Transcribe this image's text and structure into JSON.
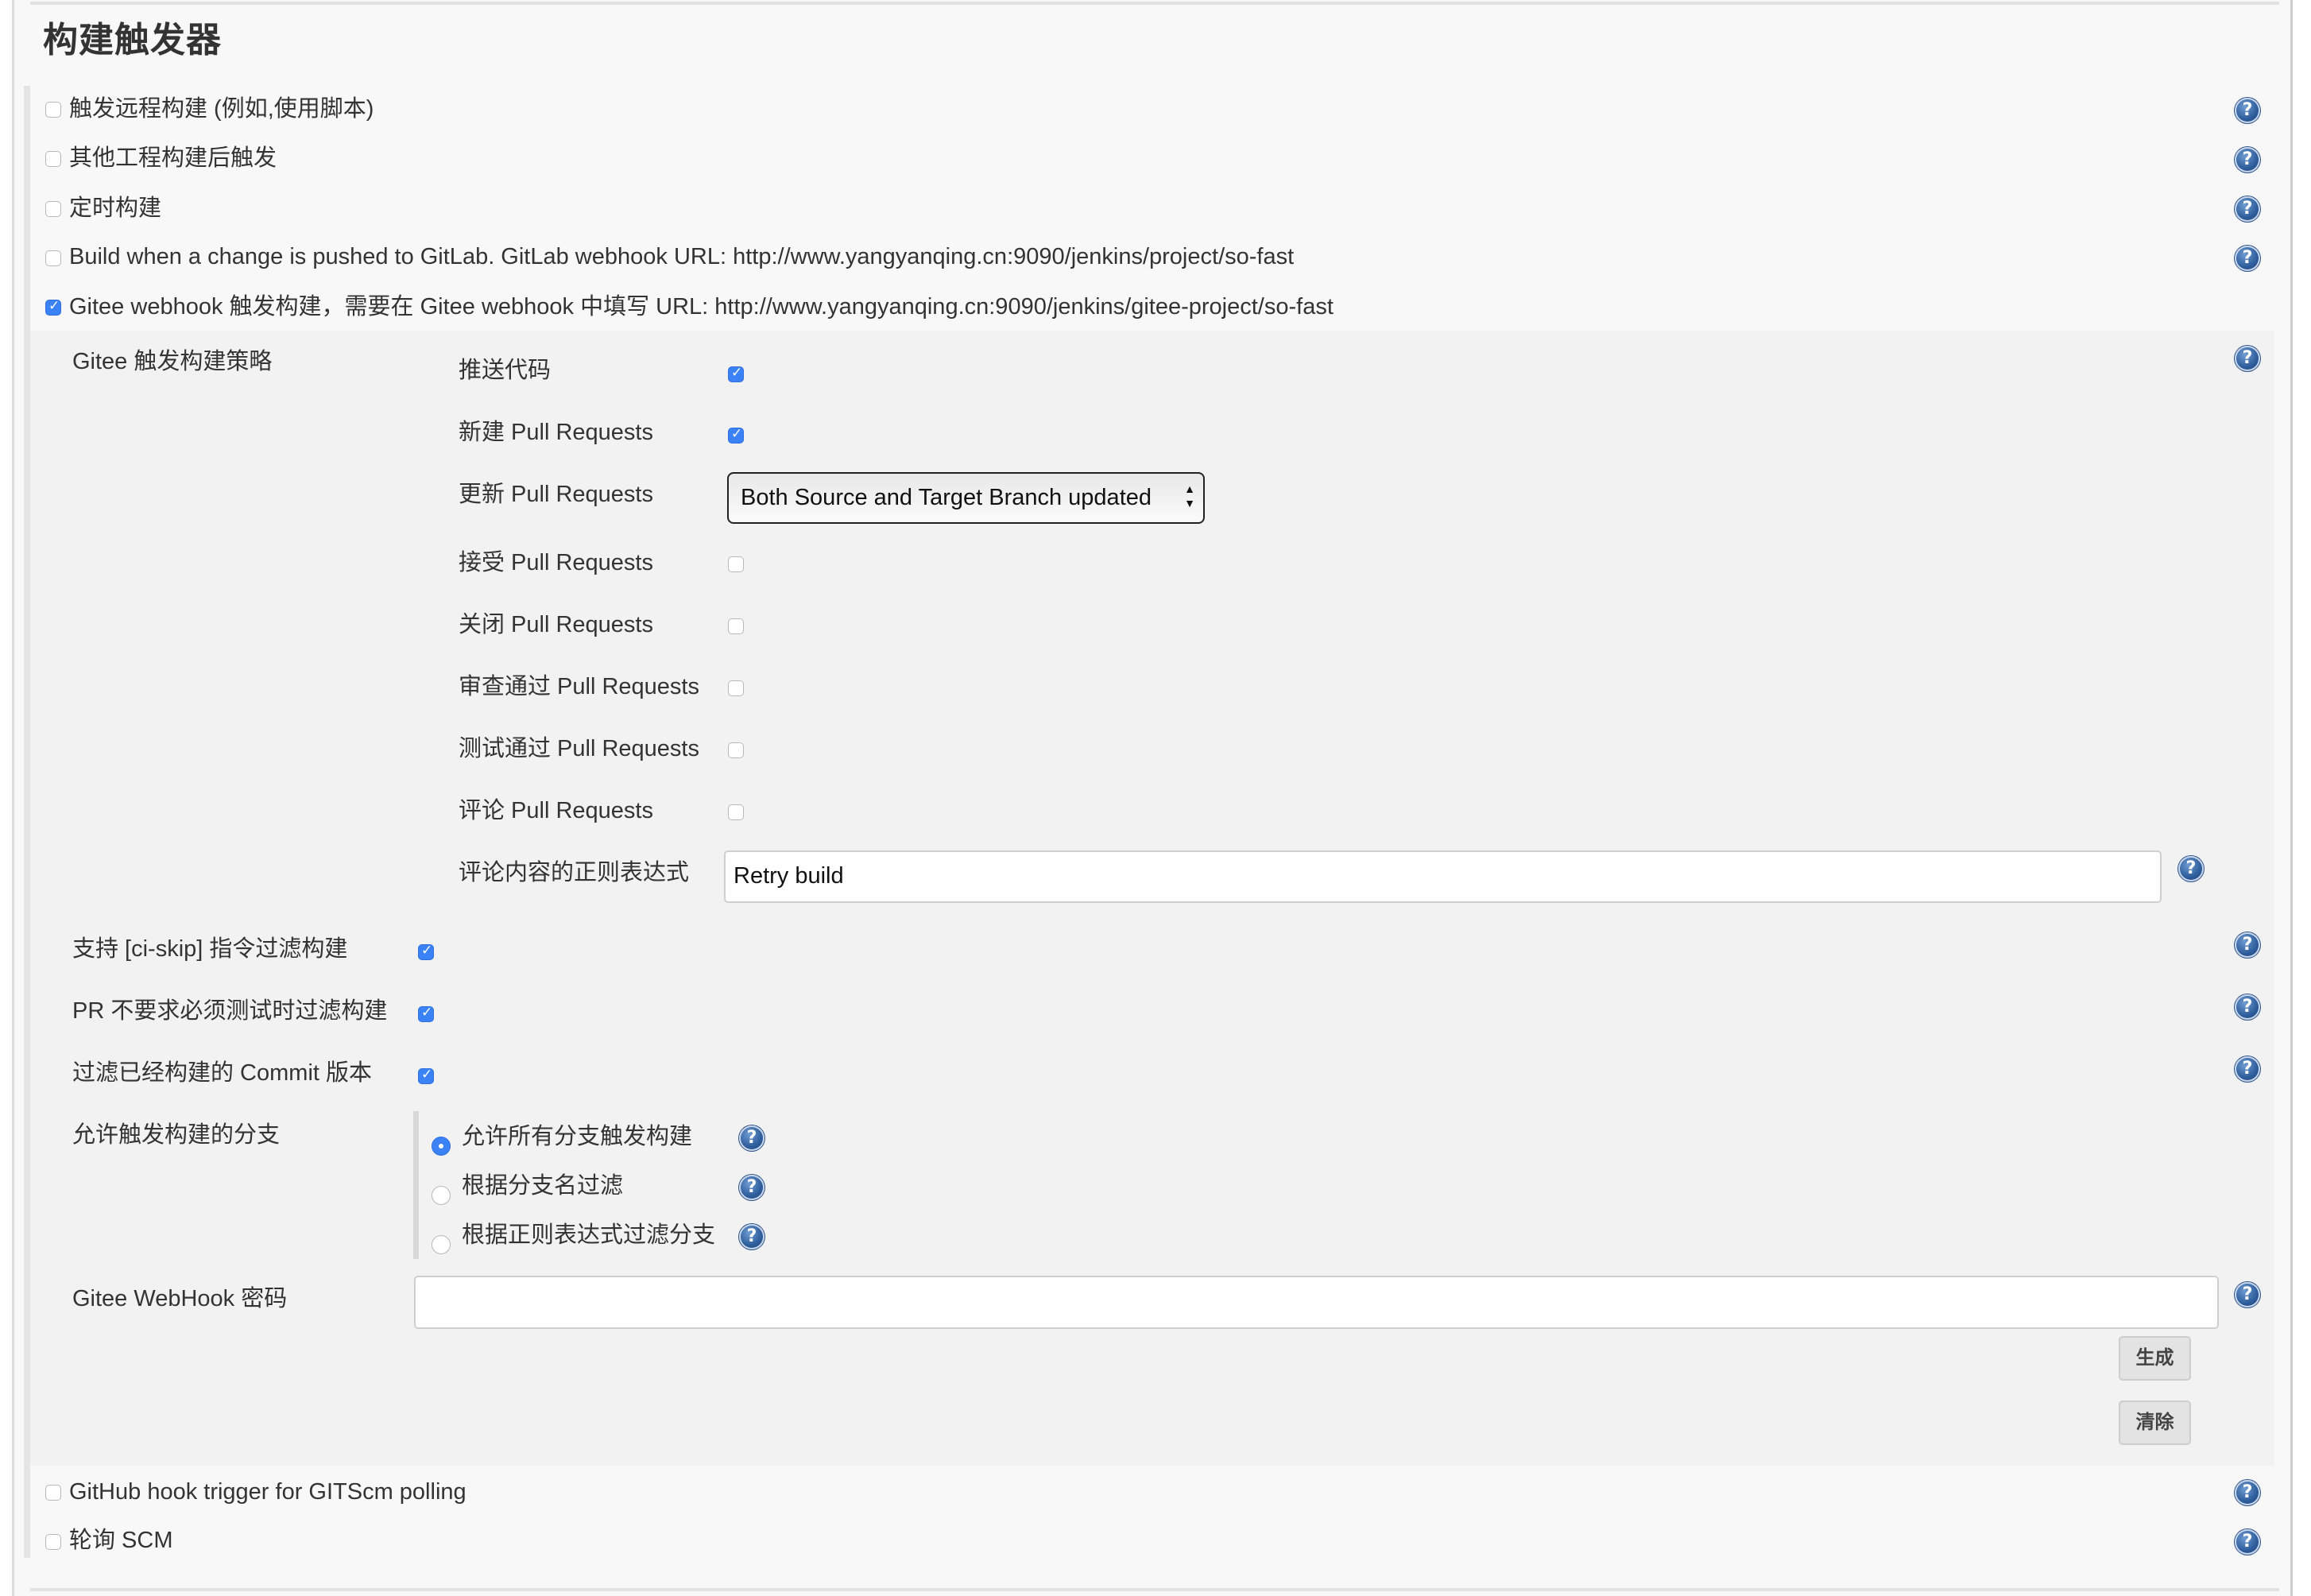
{
  "section": {
    "title": "构建触发器"
  },
  "triggers": [
    {
      "label": "触发远程构建 (例如,使用脚本)",
      "checked": false
    },
    {
      "label": "其他工程构建后触发",
      "checked": false
    },
    {
      "label": "定时构建",
      "checked": false
    },
    {
      "label": "Build when a change is pushed to GitLab. GitLab webhook URL: http://www.yangyanqing.cn:9090/jenkins/project/so-fast",
      "checked": false
    },
    {
      "label": "Gitee webhook 触发构建，需要在 Gitee webhook 中填写 URL: http://www.yangyanqing.cn:9090/jenkins/gitee-project/so-fast",
      "checked": true
    }
  ],
  "gitee": {
    "strategy_label": "Gitee 触发构建策略",
    "strategy": [
      {
        "label": "推送代码",
        "checked": true
      },
      {
        "label": "新建 Pull Requests",
        "checked": true
      },
      {
        "label": "更新 Pull Requests",
        "select_value": "Both Source and Target Branch updated"
      },
      {
        "label": "接受 Pull Requests",
        "checked": false
      },
      {
        "label": "关闭 Pull Requests",
        "checked": false
      },
      {
        "label": "审查通过 Pull Requests",
        "checked": false
      },
      {
        "label": "测试通过 Pull Requests",
        "checked": false
      },
      {
        "label": "评论 Pull Requests",
        "checked": false
      }
    ],
    "comment_regex_label": "评论内容的正则表达式",
    "comment_regex_value": "Retry build",
    "options": [
      {
        "label": "支持 [ci-skip] 指令过滤构建",
        "checked": true
      },
      {
        "label": "PR 不要求必须测试时过滤构建",
        "checked": true
      },
      {
        "label": "过滤已经构建的 Commit 版本",
        "checked": true
      }
    ],
    "branches_label": "允许触发构建的分支",
    "branches": [
      {
        "label": "允许所有分支触发构建",
        "selected": true
      },
      {
        "label": "根据分支名过滤",
        "selected": false
      },
      {
        "label": "根据正则表达式过滤分支",
        "selected": false
      }
    ],
    "webhook_password_label": "Gitee WebHook 密码",
    "webhook_password_value": "",
    "generate_button": "生成",
    "clear_button": "清除"
  },
  "more_triggers": [
    {
      "label": "GitHub hook trigger for GITScm polling",
      "checked": false
    },
    {
      "label": "轮询 SCM",
      "checked": false
    }
  ],
  "icons": {
    "help": "?",
    "select_arrows": "▲▼",
    "help_icon_name": "help-icon"
  }
}
